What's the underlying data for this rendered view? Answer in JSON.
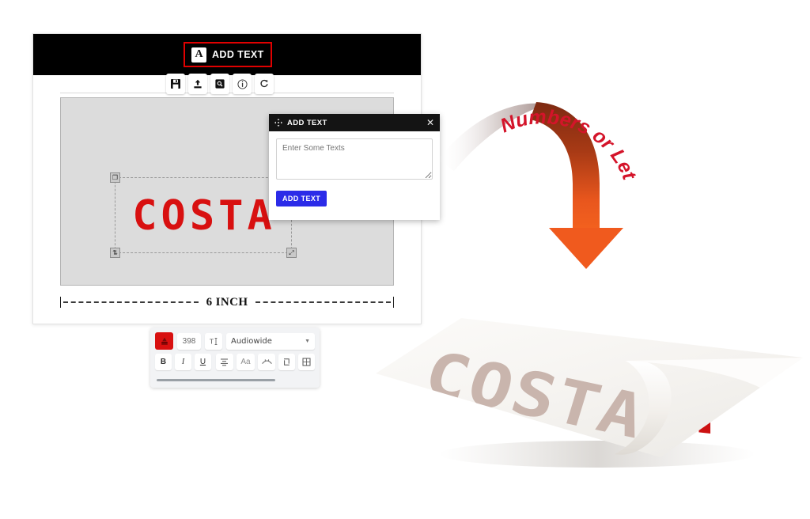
{
  "editor": {
    "topbar": {
      "chip_icon": "letter-a-icon",
      "chip_label": "ADD TEXT"
    },
    "toolbar_icons": [
      {
        "name": "save-icon",
        "label": "Save"
      },
      {
        "name": "upload-icon",
        "label": "Upload"
      },
      {
        "name": "preview-icon",
        "label": "Preview"
      },
      {
        "name": "info-icon",
        "label": "Info"
      },
      {
        "name": "reset-icon",
        "label": "Reset"
      }
    ],
    "canvas": {
      "text_object": "COSTA",
      "handles": [
        "duplicate-handle",
        "rotate-handle",
        "layers-handle",
        "resize-handle"
      ]
    },
    "format_toolbar": {
      "color_swatch": "#d81010",
      "font_size": "398",
      "line_height_icon": "text-height-icon",
      "font_family": "Audiowide",
      "dropdown_caret": "chevron-down-icon",
      "buttons": [
        {
          "name": "bold-button",
          "label": "B"
        },
        {
          "name": "italic-button",
          "label": "I"
        },
        {
          "name": "underline-button",
          "label": "U"
        },
        {
          "name": "align-button",
          "label": "align-center-icon"
        },
        {
          "name": "case-button",
          "label": "Aa"
        },
        {
          "name": "curve-button",
          "label": "curve-text-icon"
        },
        {
          "name": "flip-button",
          "label": "flip-icon"
        },
        {
          "name": "grid-button",
          "label": "grid-icon"
        }
      ]
    },
    "ruler": {
      "label": "6 INCH"
    }
  },
  "dialog": {
    "move_icon": "move-icon",
    "title": "ADD TEXT",
    "close_icon": "close-icon",
    "textarea_placeholder": "Enter Some Texts",
    "textarea_value": "",
    "submit_label": "ADD TEXT"
  },
  "annotation": {
    "caption": "Numbers or Letters",
    "caption_color": "#d4142a",
    "arrow_name": "curved-down-arrow",
    "arrow_color_top": "#8a2b10",
    "arrow_color_bottom": "#f05a1e"
  },
  "mockup": {
    "decal_text": "COSTA",
    "peeled_letter": "A",
    "decal_text_color": "#c9b5ad",
    "peeled_letter_color": "#cc1111"
  }
}
